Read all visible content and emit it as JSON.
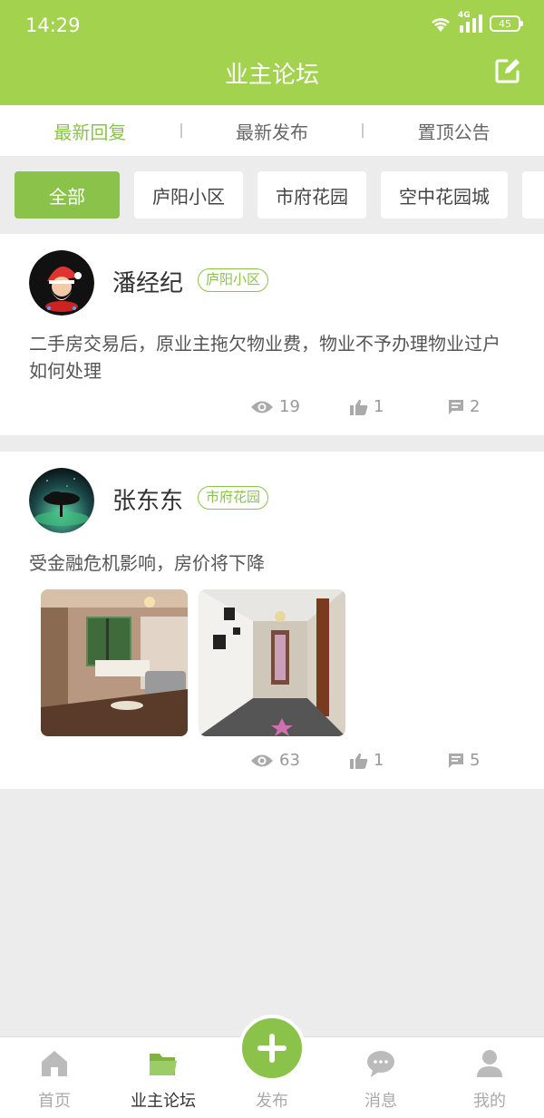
{
  "status": {
    "time": "14:29",
    "network": "4G",
    "battery": "45"
  },
  "header": {
    "title": "业主论坛"
  },
  "tabs": [
    {
      "label": "最新回复",
      "active": true
    },
    {
      "label": "最新发布",
      "active": false
    },
    {
      "label": "置顶公告",
      "active": false
    }
  ],
  "chips": [
    {
      "label": "全部",
      "active": true
    },
    {
      "label": "庐阳小区",
      "active": false
    },
    {
      "label": "市府花园",
      "active": false
    },
    {
      "label": "空中花园城",
      "active": false
    }
  ],
  "posts": [
    {
      "author": "潘经纪",
      "community": "庐阳小区",
      "content": "二手房交易后，原业主拖欠物业费，物业不予办理物业过户如何处理",
      "views": "19",
      "likes": "1",
      "comments": "2"
    },
    {
      "author": "张东东",
      "community": "市府花园",
      "content": "受金融危机影响，房价将下降",
      "views": "63",
      "likes": "1",
      "comments": "5"
    }
  ],
  "nav": [
    {
      "label": "首页",
      "icon": "home-icon"
    },
    {
      "label": "业主论坛",
      "icon": "folder-icon"
    },
    {
      "label": "发布",
      "icon": "plus-icon"
    },
    {
      "label": "消息",
      "icon": "chat-icon"
    },
    {
      "label": "我的",
      "icon": "user-icon"
    }
  ],
  "colors": {
    "primary": "#a3d24f",
    "accent": "#8bc34a"
  }
}
